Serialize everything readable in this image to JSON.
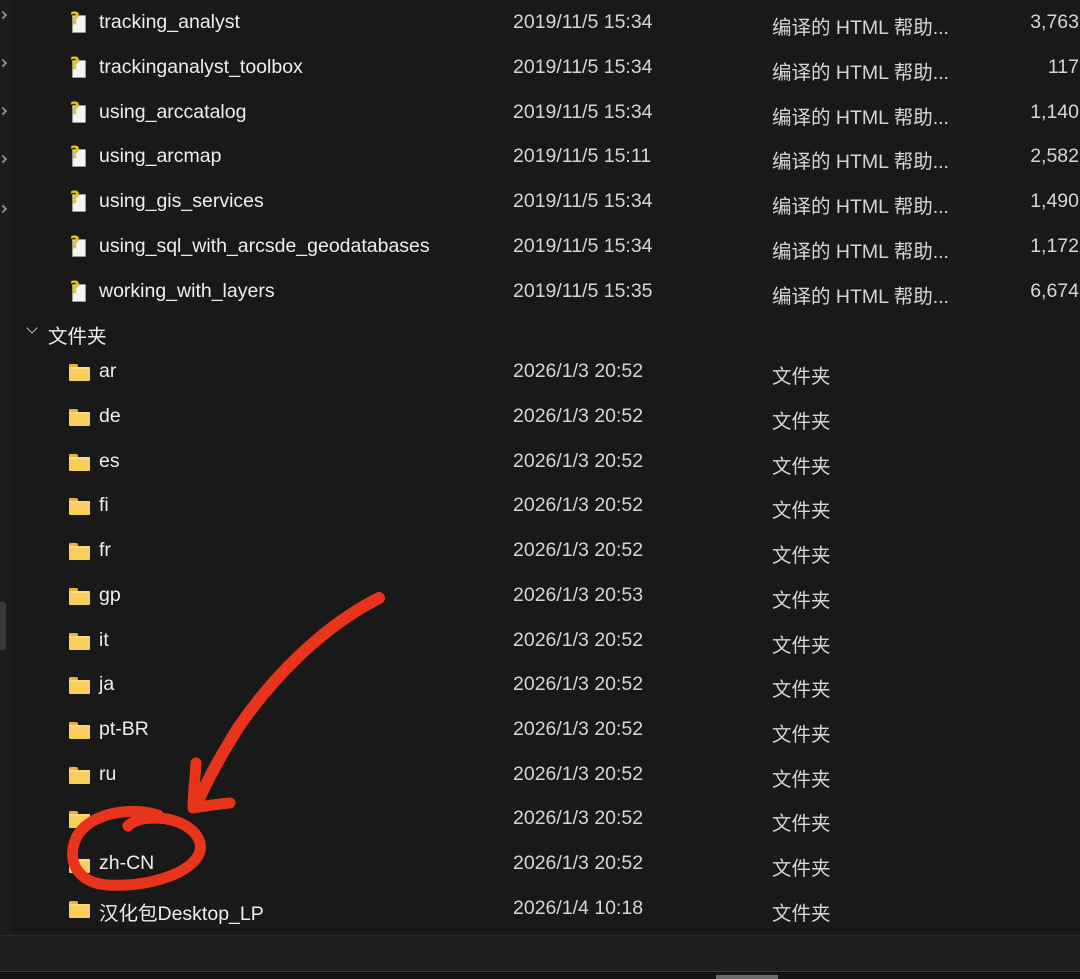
{
  "files": [
    {
      "name": "tracking_analyst",
      "date": "2019/11/5 15:34",
      "type": "编译的 HTML 帮助...",
      "size": "3,763",
      "icon": "chm-help-icon"
    },
    {
      "name": "trackinganalyst_toolbox",
      "date": "2019/11/5 15:34",
      "type": "编译的 HTML 帮助...",
      "size": "117",
      "icon": "chm-help-icon"
    },
    {
      "name": "using_arccatalog",
      "date": "2019/11/5 15:34",
      "type": "编译的 HTML 帮助...",
      "size": "1,140",
      "icon": "chm-help-icon"
    },
    {
      "name": "using_arcmap",
      "date": "2019/11/5 15:11",
      "type": "编译的 HTML 帮助...",
      "size": "2,582",
      "icon": "chm-help-icon"
    },
    {
      "name": "using_gis_services",
      "date": "2019/11/5 15:34",
      "type": "编译的 HTML 帮助...",
      "size": "1,490",
      "icon": "chm-help-icon"
    },
    {
      "name": "using_sql_with_arcsde_geodatabases",
      "date": "2019/11/5 15:34",
      "type": "编译的 HTML 帮助...",
      "size": "1,172",
      "icon": "chm-help-icon"
    },
    {
      "name": "working_with_layers",
      "date": "2019/11/5 15:35",
      "type": "编译的 HTML 帮助...",
      "size": "6,674",
      "icon": "chm-help-icon"
    }
  ],
  "folder_group": {
    "label": "文件夹",
    "icon": "chevron-down-icon"
  },
  "folders": [
    {
      "name": "ar",
      "date": "2026/1/3 20:52",
      "type": "文件夹",
      "icon": "folder-icon"
    },
    {
      "name": "de",
      "date": "2026/1/3 20:52",
      "type": "文件夹",
      "icon": "folder-icon"
    },
    {
      "name": "es",
      "date": "2026/1/3 20:52",
      "type": "文件夹",
      "icon": "folder-icon"
    },
    {
      "name": "fi",
      "date": "2026/1/3 20:52",
      "type": "文件夹",
      "icon": "folder-icon"
    },
    {
      "name": "fr",
      "date": "2026/1/3 20:52",
      "type": "文件夹",
      "icon": "folder-icon"
    },
    {
      "name": "gp",
      "date": "2026/1/3 20:53",
      "type": "文件夹",
      "icon": "folder-icon"
    },
    {
      "name": "it",
      "date": "2026/1/3 20:52",
      "type": "文件夹",
      "icon": "folder-icon"
    },
    {
      "name": "ja",
      "date": "2026/1/3 20:52",
      "type": "文件夹",
      "icon": "folder-icon"
    },
    {
      "name": "pt-BR",
      "date": "2026/1/3 20:52",
      "type": "文件夹",
      "icon": "folder-icon"
    },
    {
      "name": "ru",
      "date": "2026/1/3 20:52",
      "type": "文件夹",
      "icon": "folder-icon"
    },
    {
      "name": "",
      "date": "2026/1/3 20:52",
      "type": "文件夹",
      "icon": "folder-icon"
    },
    {
      "name": "zh-CN",
      "date": "2026/1/3 20:52",
      "type": "文件夹",
      "icon": "folder-icon"
    },
    {
      "name": "汉化包Desktop_LP",
      "date": "2026/1/4 10:18",
      "type": "文件夹",
      "icon": "folder-icon"
    }
  ],
  "annotation": {
    "color": "#e8341c",
    "shape": "arrow-and-circle",
    "target": "zh-CN"
  }
}
